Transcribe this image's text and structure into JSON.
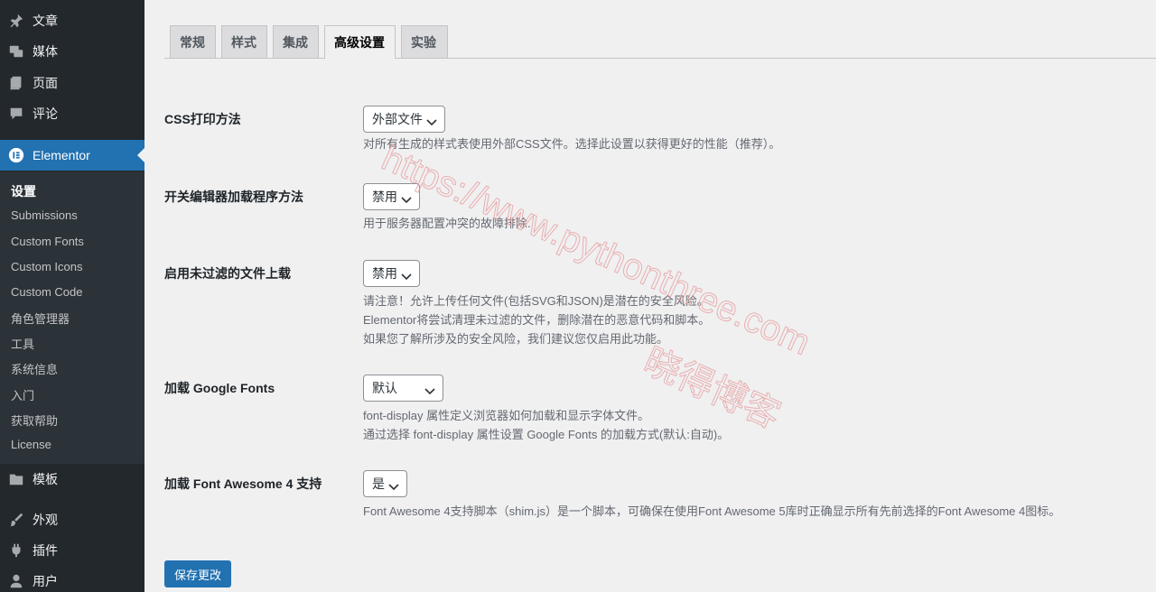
{
  "sidebar": {
    "top_items": [
      {
        "label": "文章",
        "icon": "pin-icon"
      },
      {
        "label": "媒体",
        "icon": "media-icon"
      },
      {
        "label": "页面",
        "icon": "page-icon"
      },
      {
        "label": "评论",
        "icon": "comment-icon"
      }
    ],
    "elementor": {
      "label": "Elementor",
      "icon": "elementor-icon"
    },
    "submenu": [
      "设置",
      "Submissions",
      "Custom Fonts",
      "Custom Icons",
      "Custom Code",
      "角色管理器",
      "工具",
      "系统信息",
      "入门",
      "获取帮助",
      "License"
    ],
    "bottom_items": [
      {
        "label": "模板",
        "icon": "folder-icon"
      },
      {
        "label": "外观",
        "icon": "brush-icon"
      },
      {
        "label": "插件",
        "icon": "plugin-icon"
      },
      {
        "label": "用户",
        "icon": "user-icon"
      }
    ]
  },
  "tabs": [
    "常规",
    "样式",
    "集成",
    "高级设置",
    "实验"
  ],
  "active_tab": "高级设置",
  "fields": {
    "css_print": {
      "label": "CSS打印方法",
      "value": "外部文件",
      "desc": [
        "对所有生成的样式表使用外部CSS文件。选择此设置以获得更好的性能（推荐）。"
      ]
    },
    "editor_loader": {
      "label": "开关编辑器加载程序方法",
      "value": "禁用",
      "desc": [
        "用于服务器配置冲突的故障排除."
      ]
    },
    "unfiltered_upload": {
      "label": "启用未过滤的文件上载",
      "value": "禁用",
      "desc": [
        "请注意！允许上传任何文件(包括SVG和JSON)是潜在的安全风险。",
        "Elementor将尝试清理未过滤的文件，删除潜在的恶意代码和脚本。",
        "如果您了解所涉及的安全风险，我们建议您仅启用此功能。"
      ]
    },
    "google_fonts": {
      "label": "加载 Google Fonts",
      "value": "默认",
      "desc": [
        "font-display 属性定义浏览器如何加载和显示字体文件。",
        "通过选择 font-display 属性设置 Google Fonts 的加载方式(默认:自动)。"
      ]
    },
    "font_awesome": {
      "label": "加载 Font Awesome 4 支持",
      "value": "是",
      "desc": [
        "Font Awesome 4支持脚本（shim.js）是一个脚本，可确保在使用Font Awesome 5库时正确显示所有先前选择的Font Awesome 4图标。"
      ]
    }
  },
  "save_label": "保存更改",
  "watermark": {
    "line1": "https://www.pythonthree.com",
    "line2": "晓得博客"
  },
  "colors": {
    "accent": "#2271b1",
    "sidebar_bg": "#23282d",
    "submenu_bg": "#2c3338",
    "watermark": "#e8a0a0"
  }
}
